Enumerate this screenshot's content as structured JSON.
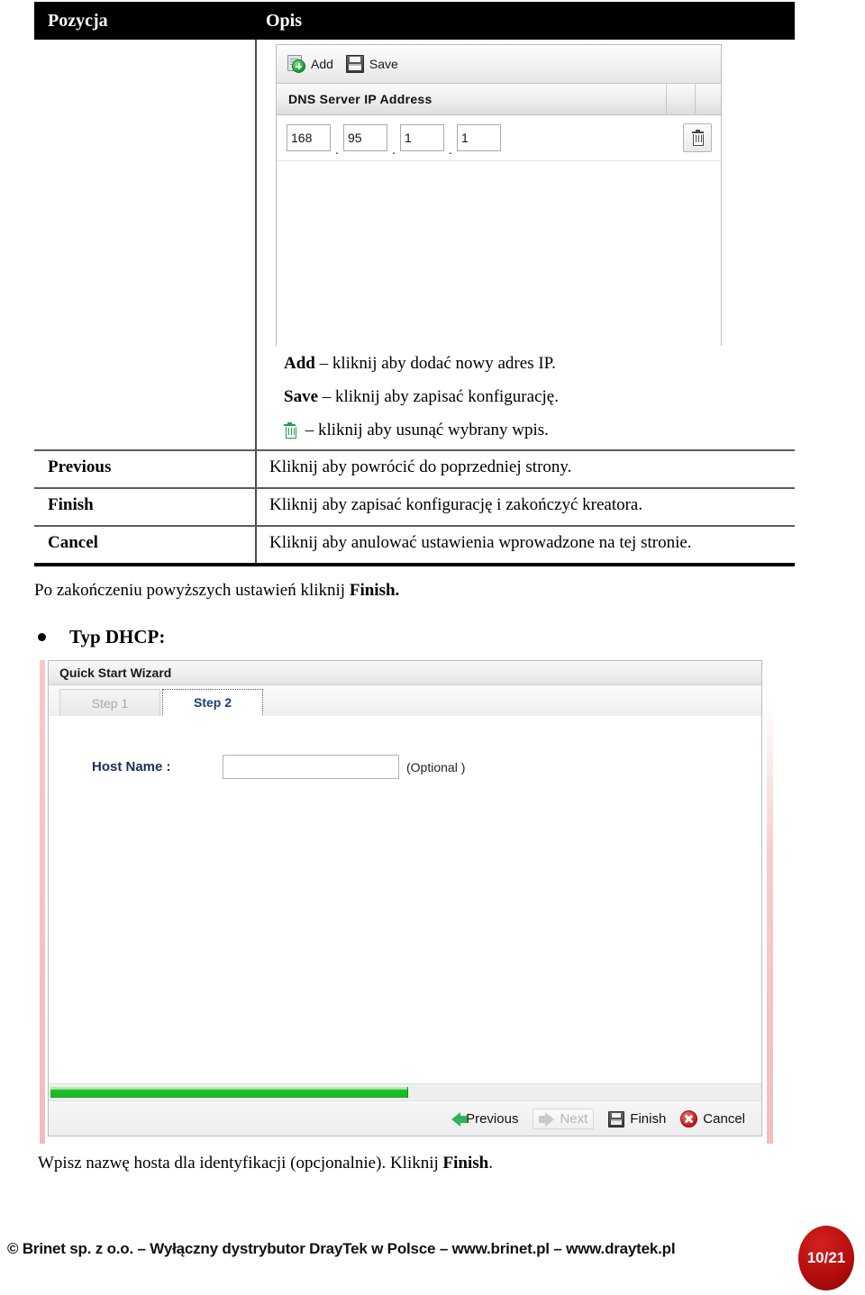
{
  "table": {
    "headers": [
      "Pozycja",
      "Opis"
    ],
    "rows": [
      {
        "item": "",
        "lines": [
          {
            "bold": "Add",
            "rest": " – kliknij aby dodać nowy adres IP."
          },
          {
            "bold": "Save",
            "rest": " – kliknij aby zapisać konfigurację."
          },
          {
            "icon": "trash-icon",
            "rest": " – kliknij aby usunąć wybrany wpis."
          }
        ]
      },
      {
        "item": "Previous",
        "desc": "Kliknij aby powrócić do poprzedniej strony."
      },
      {
        "item": "Finish",
        "desc": "Kliknij aby zapisać konfigurację i zakończyć kreatora."
      },
      {
        "item": "Cancel",
        "desc": "Kliknij aby anulować ustawienia wprowadzone na tej stronie."
      }
    ]
  },
  "dns_panel": {
    "toolbar": {
      "add_label": "Add",
      "save_label": "Save"
    },
    "column_header": "DNS Server IP Address",
    "ip_octets": [
      "168",
      "95",
      "1",
      "1"
    ],
    "separator": "."
  },
  "after_table_note": "Po zakończeniu powyższych ustawień kliknij ",
  "after_table_note_bold": "Finish.",
  "bullet": {
    "label": "Typ DHCP:"
  },
  "wizard": {
    "title": "Quick Start Wizard",
    "tabs": [
      {
        "label": "Step 1",
        "active": false
      },
      {
        "label": "Step 2",
        "active": true
      }
    ],
    "host_name_label": "Host Name :",
    "host_name_value": "",
    "host_name_optional": "(Optional )",
    "progress_percent": 50,
    "buttons": [
      {
        "label": "Previous",
        "icon": "arrow-left-icon",
        "disabled": false
      },
      {
        "label": "Next",
        "icon": "arrow-right-icon",
        "disabled": true
      },
      {
        "label": "Finish",
        "icon": "floppy-disk-icon",
        "disabled": false
      },
      {
        "label": "Cancel",
        "icon": "cancel-circle-icon",
        "disabled": false
      }
    ]
  },
  "closing_note": {
    "text": "Wpisz nazwę hosta dla identyfikacji (opcjonalnie). Kliknij ",
    "bold": "Finish",
    "tail": "."
  },
  "footer": {
    "copyright": "© Brinet sp. z o.o. – Wyłączny dystrybutor DrayTek w Polsce – www.brinet.pl – www.draytek.pl",
    "page_number": "10/21"
  }
}
